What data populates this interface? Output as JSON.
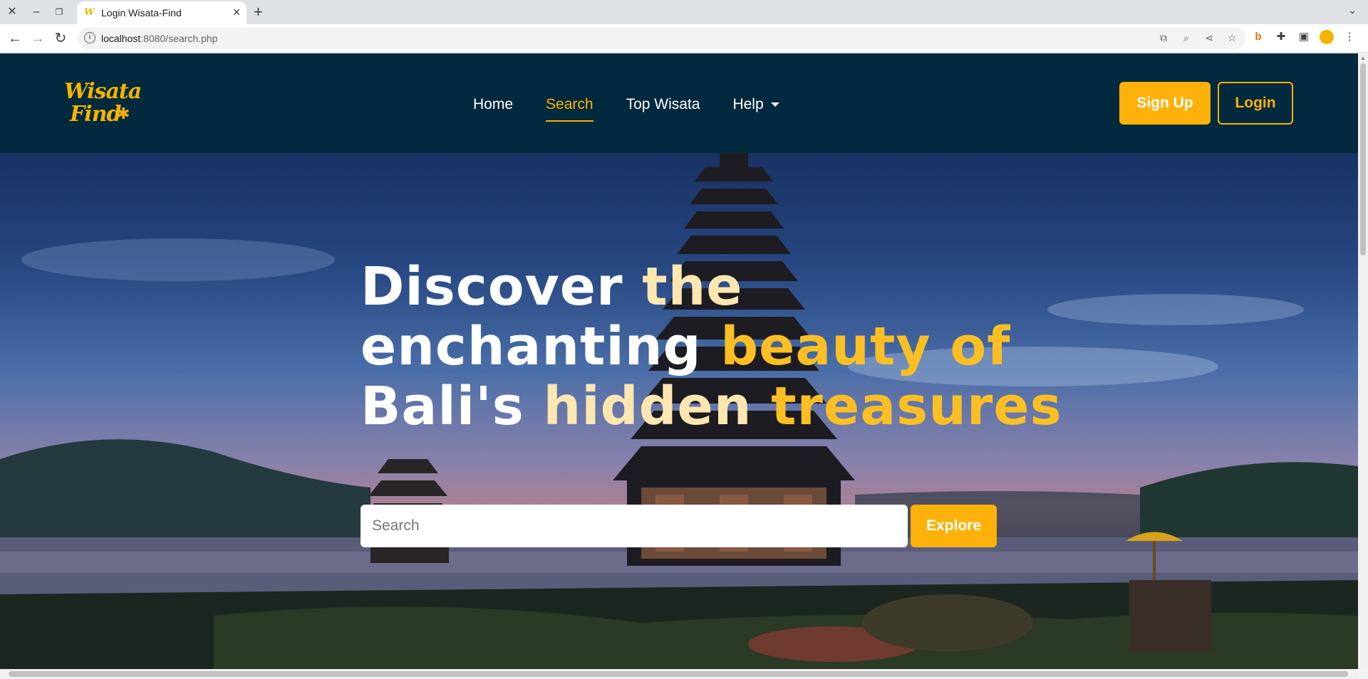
{
  "browser": {
    "tab_title": "Login Wisata-Find",
    "url_host": "localhost",
    "url_path": ":8080/search.php",
    "icons": [
      "close-icon",
      "minimize-icon",
      "restore-icon",
      "plus-icon",
      "chevron-down-icon",
      "back-icon",
      "forward-icon",
      "reload-icon",
      "info-icon",
      "translate-icon",
      "zoom-icon",
      "share-icon",
      "star-icon",
      "extension-icon",
      "puzzle-icon",
      "sidebar-icon",
      "profile-icon",
      "more-icon"
    ]
  },
  "site": {
    "logo_line1": "Wisata",
    "logo_line2": "Find",
    "nav": {
      "home": "Home",
      "search": "Search",
      "top_wisata": "Top Wisata",
      "help": "Help"
    },
    "signup": "Sign Up",
    "login": "Login"
  },
  "hero": {
    "line1_a": "Discover ",
    "line1_b": "the",
    "line2_a": "enchanting ",
    "line2_b": "beauty of",
    "line3_a": "Bali's ",
    "line3_b": "hidden ",
    "line3_c": "treasures",
    "search_placeholder": "Search",
    "explore": "Explore"
  },
  "colors": {
    "nav_bg": "#02293d",
    "accent": "#fdb10a"
  }
}
